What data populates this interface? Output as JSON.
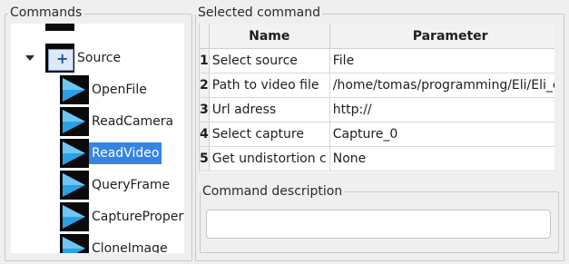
{
  "commands": {
    "title": "Commands",
    "root": {
      "label": "Source",
      "icon": "folder-plus-icon",
      "expanded": true
    },
    "items": [
      {
        "label": "OpenFile",
        "icon": "play-icon"
      },
      {
        "label": "ReadCamera",
        "icon": "play-icon"
      },
      {
        "label": "ReadVideo",
        "icon": "play-icon",
        "selected": true
      },
      {
        "label": "QueryFrame",
        "icon": "play-icon"
      },
      {
        "label": "CaptureProperty",
        "icon": "play-icon"
      },
      {
        "label": "CloneImage",
        "icon": "play-icon"
      }
    ]
  },
  "selected_command": {
    "title": "Selected command",
    "columns": [
      "Name",
      "Parameter"
    ],
    "rows": [
      {
        "num": "1",
        "name": "Select source",
        "param": "File"
      },
      {
        "num": "2",
        "name": "Path to video file",
        "param": "/home/tomas/programming/Eli/Eli_ex"
      },
      {
        "num": "3",
        "name": "Url adress",
        "param": "http://"
      },
      {
        "num": "4",
        "name": "Select capture",
        "param": "Capture_0"
      },
      {
        "num": "5",
        "name": "Get undistortion c",
        "param": "None"
      }
    ]
  },
  "description": {
    "title": "Command description",
    "value": ""
  },
  "colors": {
    "selection": "#3584e4",
    "play_icon_blue": "#2aa0e8",
    "icon_bg": "#0a0a0a"
  }
}
